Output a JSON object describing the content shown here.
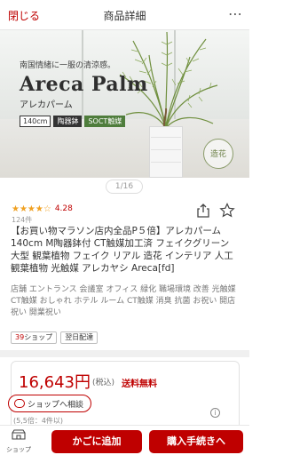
{
  "header": {
    "close_label": "閉じる",
    "title": "商品詳細",
    "more_glyph": "⋯"
  },
  "hero": {
    "subtitle": "南国情緒に一服の清涼感。",
    "title": "Areca Palm",
    "title_jp": "アレカパーム",
    "tags": [
      "140cm",
      "陶器鉢",
      "SOCT触媒"
    ],
    "badge": "造花",
    "pager": "1/16"
  },
  "product": {
    "stars": "★★★★☆",
    "rating": "4.28",
    "reviews": "124件",
    "title": "【お買い物マラソン店内全品P５倍】アレカパーム 140cm M陶器鉢付 CT触媒加工済 フェイクグリーン 大型 観葉植物 フェイク リアル 造花 インテリア 人工観葉植物 光触媒 アレカヤシ Areca[fd]",
    "subtitle": "店舗 エントランス 会議室 オフィス 緑化 職場環境 改善 光触媒 CT触媒 おしゃれ ホテル ルーム CT触媒 消臭 抗菌 お祝い 開店祝い 開業祝い",
    "badges": {
      "points_prefix": "39",
      "points_suffix": "ショップ",
      "delivery": "翌日配達"
    }
  },
  "price": {
    "value": "16,643円",
    "tax": "(税込)",
    "shipping": "送料無料",
    "qty_note": "(5,5倍：4件以)",
    "info": "i"
  },
  "contact": {
    "label": "ショップへ相談"
  },
  "bottom": {
    "shop_label": "ショップ",
    "cart_label": "かごに追加",
    "buy_label": "購入手続きへ"
  },
  "colors": {
    "brand": "#bf0000",
    "star": "#f0a020"
  }
}
